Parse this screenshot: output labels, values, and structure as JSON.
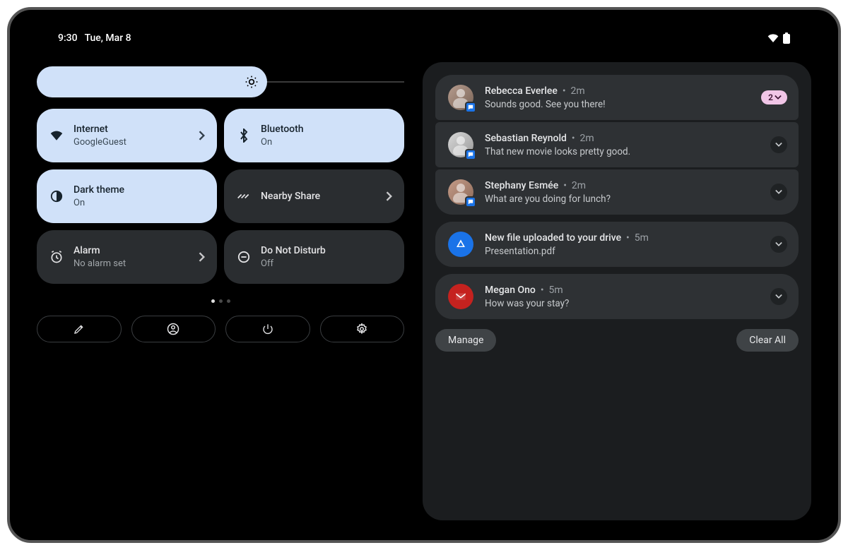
{
  "status": {
    "time": "9:30",
    "date": "Tue, Mar 8"
  },
  "tiles": {
    "internet": {
      "title": "Internet",
      "sub": "GoogleGuest"
    },
    "bluetooth": {
      "title": "Bluetooth",
      "sub": "On"
    },
    "darktheme": {
      "title": "Dark theme",
      "sub": "On"
    },
    "nearby": {
      "title": "Nearby Share",
      "sub": ""
    },
    "alarm": {
      "title": "Alarm",
      "sub": "No alarm set"
    },
    "dnd": {
      "title": "Do Not Disturb",
      "sub": "Off"
    }
  },
  "notifications": [
    {
      "sender": "Rebecca Everlee",
      "time": "2m",
      "body": "Sounds good. See you there!",
      "count": "2"
    },
    {
      "sender": "Sebastian Reynold",
      "time": "2m",
      "body": "That new movie looks pretty good."
    },
    {
      "sender": "Stephany Esmée",
      "time": "2m",
      "body": "What are you doing for lunch?"
    },
    {
      "sender": "New file uploaded to your drive",
      "time": "5m",
      "body": "Presentation.pdf"
    },
    {
      "sender": "Megan Ono",
      "time": "5m",
      "body": "How was your stay?"
    }
  ],
  "footer": {
    "manage": "Manage",
    "clear": "Clear All"
  }
}
